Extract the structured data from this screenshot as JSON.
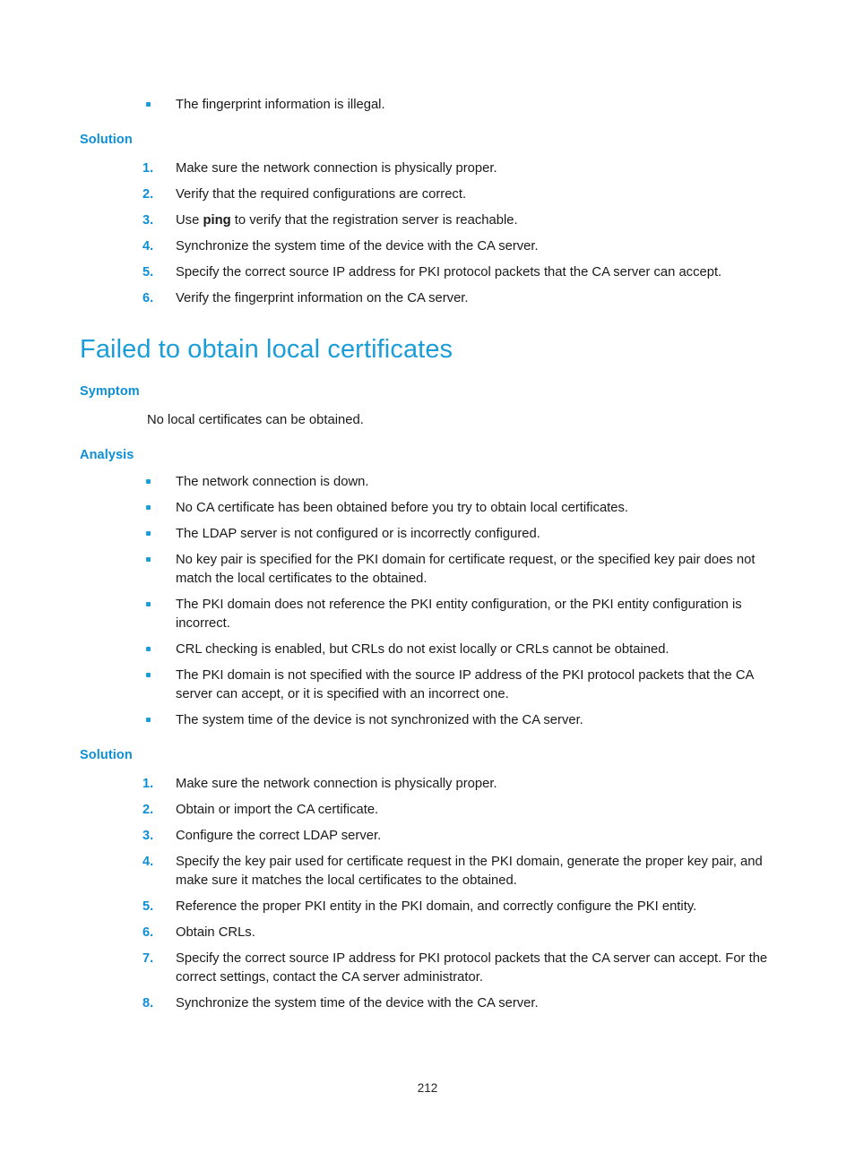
{
  "page": {
    "number": "212"
  },
  "colors": {
    "heading_blue": "#1b9dd9",
    "subheading_blue": "#0e8fd4",
    "bullet_blue": "#1b9dd9",
    "body_text": "#1a1a1a"
  },
  "top_bullets": [
    "The fingerprint information is illegal."
  ],
  "first_solution": {
    "heading": "Solution",
    "steps": [
      {
        "number": "1.",
        "text": "Make sure the network connection is physically proper."
      },
      {
        "number": "2.",
        "text": "Verify that the required configurations are correct."
      },
      {
        "number": "3.",
        "text_before": "Use ",
        "bold": "ping",
        "text_after": " to verify that the registration server is reachable."
      },
      {
        "number": "4.",
        "text": "Synchronize the system time of the device with the CA server."
      },
      {
        "number": "5.",
        "text": "Specify the correct source IP address for PKI protocol packets that the CA server can accept."
      },
      {
        "number": "6.",
        "text": "Verify the fingerprint information on the CA server."
      }
    ]
  },
  "section": {
    "title": "Failed to obtain local certificates",
    "symptom": {
      "heading": "Symptom",
      "text": "No local certificates can be obtained."
    },
    "analysis": {
      "heading": "Analysis",
      "bullets": [
        "The network connection is down.",
        "No CA certificate has been obtained before you try to obtain local certificates.",
        "The LDAP server is not configured or is incorrectly configured.",
        "No key pair is specified for the PKI domain for certificate request, or the specified key pair does not match the local certificates to the obtained.",
        "The PKI domain does not reference the PKI entity configuration, or the PKI entity configuration is incorrect.",
        "CRL checking is enabled, but CRLs do not exist locally or CRLs cannot be obtained.",
        "The PKI domain is not specified with the source IP address of the PKI protocol packets that the CA server can accept, or it is specified with an incorrect one.",
        "The system time of the device is not synchronized with the CA server."
      ]
    },
    "solution": {
      "heading": "Solution",
      "steps": [
        {
          "number": "1.",
          "text": "Make sure the network connection is physically proper."
        },
        {
          "number": "2.",
          "text": "Obtain or import the CA certificate."
        },
        {
          "number": "3.",
          "text": "Configure the correct LDAP server."
        },
        {
          "number": "4.",
          "text": "Specify the key pair used for certificate request in the PKI domain, generate the proper key pair, and make sure it matches the local certificates to the obtained."
        },
        {
          "number": "5.",
          "text": "Reference the proper PKI entity in the PKI domain, and correctly configure the PKI entity."
        },
        {
          "number": "6.",
          "text": "Obtain CRLs."
        },
        {
          "number": "7.",
          "text": "Specify the correct source IP address for PKI protocol packets that the CA server can accept. For the correct settings, contact the CA server administrator."
        },
        {
          "number": "8.",
          "text": "Synchronize the system time of the device with the CA server."
        }
      ]
    }
  }
}
